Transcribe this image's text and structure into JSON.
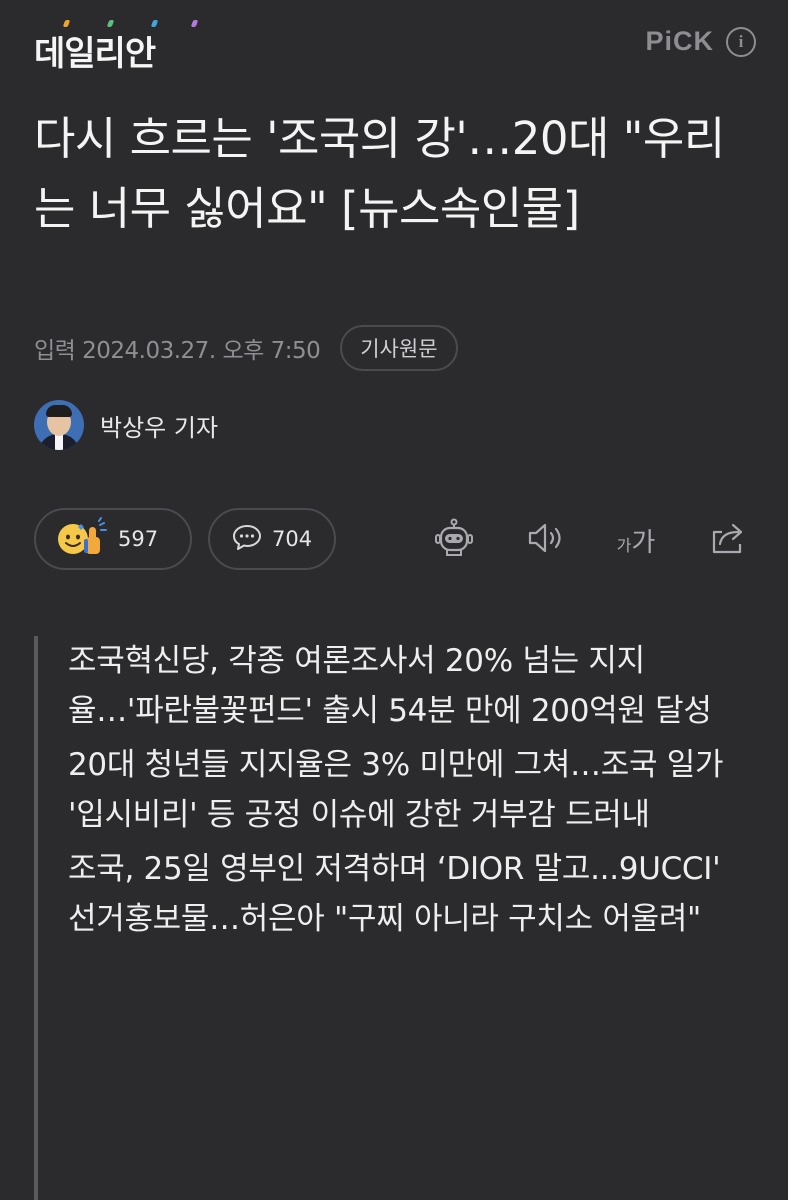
{
  "header": {
    "logo_text": "데일리안",
    "logo_dot_colors": [
      "#f0a52a",
      "#5ac27a",
      "#3fa7e0",
      "#b57ae0"
    ],
    "pick_label": "PiCK",
    "info_icon": "info-icon"
  },
  "article": {
    "title": "다시 흐르는 '조국의 강'…20대 \"우리는 너무 싫어요\" [뉴스속인물]",
    "published": "입력 2024.03.27. 오후 7:50",
    "source_button": "기사원문",
    "author": "박상우 기자"
  },
  "actions": {
    "like_count": "597",
    "comment_count": "704",
    "robot_icon": "robot-icon",
    "speaker_icon": "speaker-icon",
    "font_small": "가",
    "font_large": "가",
    "share_icon": "share-icon"
  },
  "summary": [
    "조국혁신당, 각종 여론조사서 20% 넘는 지지율…'파란불꽃펀드' 출시 54분 만에 200억원 달성",
    "20대 청년들 지지율은 3% 미만에 그쳐…조국 일가 '입시비리' 등 공정 이슈에 강한 거부감 드러내",
    "조국, 25일 영부인 저격하며 ‘DIOR 말고...9UCCI' 선거홍보물…허은아 \"구찌 아니라 구치소 어울려\""
  ],
  "colors": {
    "background": "#2b2b2e",
    "text": "#f4f4f4",
    "muted": "#8e8e93",
    "border": "#4a4a4f"
  }
}
